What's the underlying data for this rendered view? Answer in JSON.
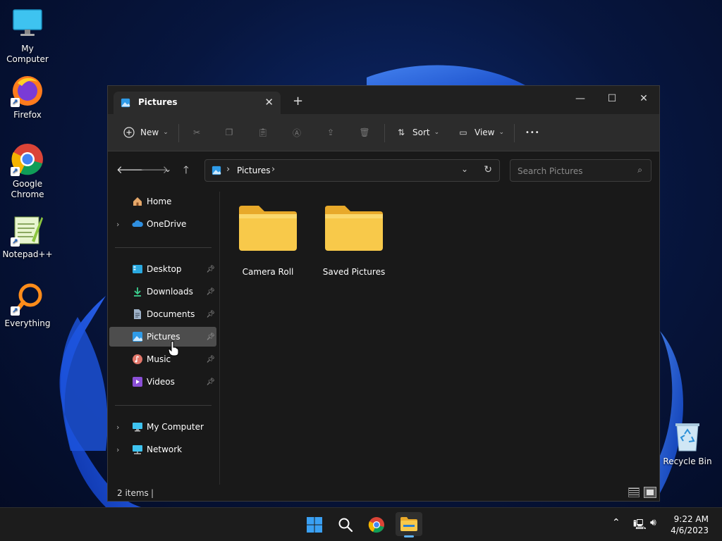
{
  "desktop": {
    "icons": [
      {
        "label": "My Computer"
      },
      {
        "label": "Firefox"
      },
      {
        "label": "Google Chrome"
      },
      {
        "label": "Notepad++"
      },
      {
        "label": "Everything"
      },
      {
        "label": "Recycle Bin"
      }
    ]
  },
  "window": {
    "tab_title": "Pictures",
    "tab_close": "✕",
    "new_tab": "+",
    "controls": {
      "minimize": "—",
      "maximize": "☐",
      "close": "✕"
    },
    "toolbar": {
      "new_label": "New",
      "sort_label": "Sort",
      "view_label": "View",
      "more_label": "•••"
    },
    "address": {
      "crumb": "Pictures",
      "separator": "›"
    },
    "search": {
      "placeholder": "Search Pictures"
    },
    "sidebar": {
      "home": "Home",
      "onedrive": "OneDrive",
      "desktop": "Desktop",
      "downloads": "Downloads",
      "documents": "Documents",
      "pictures": "Pictures",
      "music": "Music",
      "videos": "Videos",
      "my_computer": "My Computer",
      "network": "Network"
    },
    "folders": [
      {
        "name": "Camera Roll"
      },
      {
        "name": "Saved Pictures"
      }
    ],
    "status": {
      "item_count": "2 items"
    }
  },
  "taskbar": {
    "time": "9:22 AM",
    "date": "4/6/2023"
  },
  "colors": {
    "folder": "#f8c94a",
    "accent": "#0a78d4",
    "window_bg": "#191919"
  }
}
